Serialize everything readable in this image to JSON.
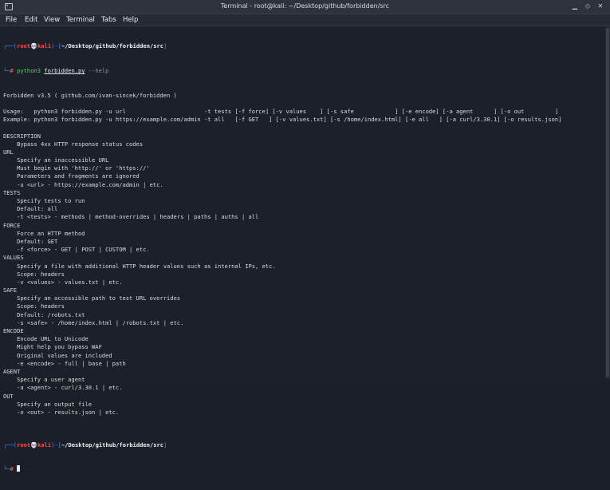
{
  "window": {
    "title": "Terminal - root@kali: ~/Desktop/github/forbidden/src"
  },
  "menu": [
    "File",
    "Edit",
    "View",
    "Terminal",
    "Tabs",
    "Help"
  ],
  "prompt": {
    "corner_top": "┌──(",
    "user": "root",
    "skull": "💀",
    "host": "kali",
    "mid": ")-[",
    "path": "~/Desktop/github/forbidden/src",
    "end": "]",
    "corner_bottom": "└─",
    "hash": "#"
  },
  "command": {
    "prog": "python3",
    "file": "forbidden.py",
    "arg": "--help"
  },
  "output": [
    "Forbidden v3.5 ( github.com/ivan-sincek/forbidden )",
    "",
    "Usage:   python3 forbidden.py -u url                       -t tests [-f force] [-v values    ] [-s safe            ] [-e encode] [-a agent      ] [-o out         ]",
    "Example: python3 forbidden.py -u https://example.com/admin -t all   [-f GET   ] [-v values.txt] [-s /home/index.html] [-e all   ] [-a curl/3.30.1] [-o results.json]",
    "",
    "DESCRIPTION",
    "    Bypass 4xx HTTP response status codes",
    "URL",
    "    Specify an inaccessible URL",
    "    Must begin with 'http://' or 'https://'",
    "    Parameters and fragments are ignored",
    "    -u <url> - https://example.com/admin | etc.",
    "TESTS",
    "    Specify tests to run",
    "    Default: all",
    "    -t <tests> - methods | method-overrides | headers | paths | auths | all",
    "FORCE",
    "    Force an HTTP method",
    "    Default: GET",
    "    -f <force> - GET | POST | CUSTOM | etc.",
    "VALUES",
    "    Specify a file with additional HTTP header values such as internal IPs, etc.",
    "    Scope: headers",
    "    -v <values> - values.txt | etc.",
    "SAFE",
    "    Specify an accessible path to test URL overrides",
    "    Scope: headers",
    "    Default: /robots.txt",
    "    -s <safe> - /home/index.html | /robots.txt | etc.",
    "ENCODE",
    "    Encode URL to Unicode",
    "    Might help you bypass WAF",
    "    Original values are included",
    "    -e <encode> - full | base | path",
    "AGENT",
    "    Specify a user agent",
    "    -a <agent> - curl/3.30.1 | etc.",
    "OUT",
    "    Specify an output file",
    "    -o <out> - results.json | etc.",
    ""
  ]
}
